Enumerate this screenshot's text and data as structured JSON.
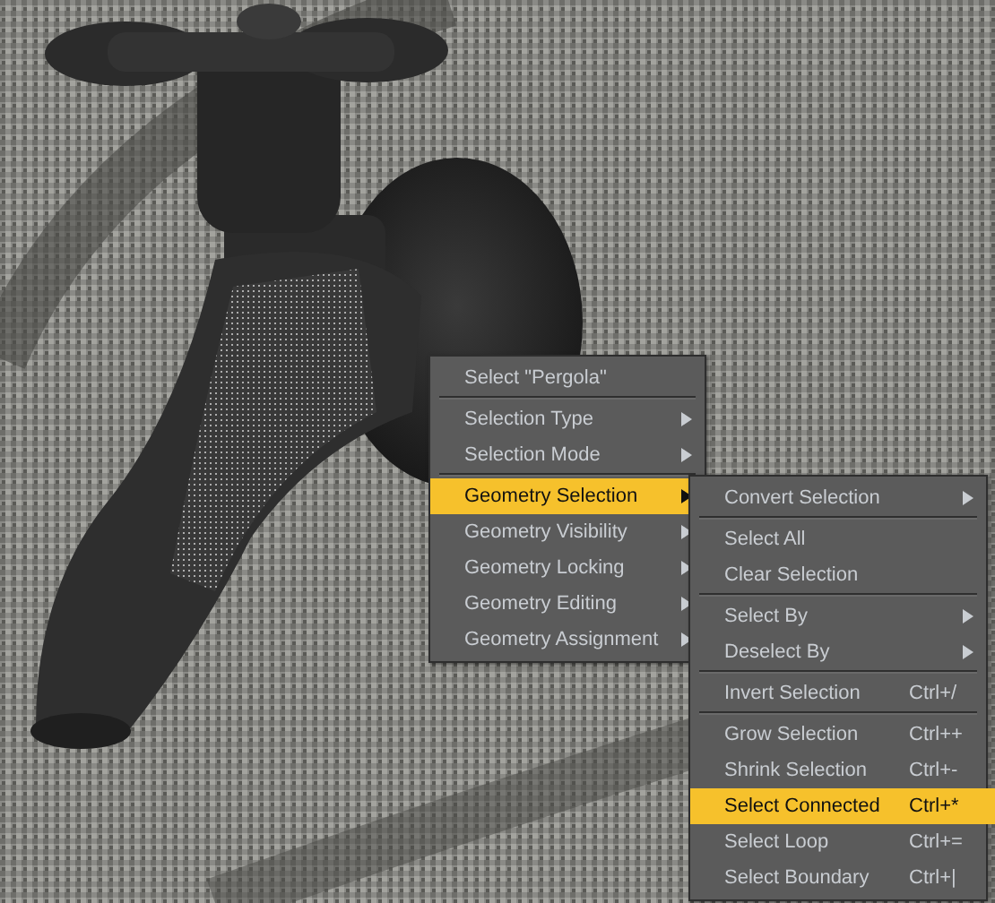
{
  "menus": [
    {
      "items": [
        {
          "kind": "item",
          "label": "Select \"Pergola\"",
          "submenu": false,
          "selected": false
        },
        {
          "kind": "separator"
        },
        {
          "kind": "item",
          "label": "Selection Type",
          "submenu": true,
          "selected": false
        },
        {
          "kind": "item",
          "label": "Selection Mode",
          "submenu": true,
          "selected": false
        },
        {
          "kind": "separator"
        },
        {
          "kind": "item",
          "label": "Geometry Selection",
          "submenu": true,
          "selected": true
        },
        {
          "kind": "item",
          "label": "Geometry Visibility",
          "submenu": true,
          "selected": false
        },
        {
          "kind": "item",
          "label": "Geometry Locking",
          "submenu": true,
          "selected": false
        },
        {
          "kind": "item",
          "label": "Geometry Editing",
          "submenu": true,
          "selected": false
        },
        {
          "kind": "item",
          "label": "Geometry Assignment",
          "submenu": true,
          "selected": false
        }
      ]
    },
    {
      "items": [
        {
          "kind": "item",
          "label": "Convert Selection",
          "submenu": true,
          "selected": false
        },
        {
          "kind": "separator"
        },
        {
          "kind": "item",
          "label": "Select All",
          "submenu": false,
          "selected": false
        },
        {
          "kind": "item",
          "label": "Clear Selection",
          "submenu": false,
          "selected": false
        },
        {
          "kind": "separator"
        },
        {
          "kind": "item",
          "label": "Select By",
          "submenu": true,
          "selected": false
        },
        {
          "kind": "item",
          "label": "Deselect By",
          "submenu": true,
          "selected": false
        },
        {
          "kind": "separator"
        },
        {
          "kind": "item",
          "label": "Invert Selection",
          "shortcut": "Ctrl+/",
          "submenu": false,
          "selected": false
        },
        {
          "kind": "separator"
        },
        {
          "kind": "item",
          "label": "Grow Selection",
          "shortcut": "Ctrl++",
          "submenu": false,
          "selected": false
        },
        {
          "kind": "item",
          "label": "Shrink Selection",
          "shortcut": "Ctrl+-",
          "submenu": false,
          "selected": false
        },
        {
          "kind": "item",
          "label": "Select Connected",
          "shortcut": "Ctrl+*",
          "submenu": false,
          "selected": true
        },
        {
          "kind": "item",
          "label": "Select Loop",
          "shortcut": "Ctrl+=",
          "submenu": false,
          "selected": false
        },
        {
          "kind": "item",
          "label": "Select Boundary",
          "shortcut": "Ctrl+|",
          "submenu": false,
          "selected": false
        }
      ]
    }
  ]
}
